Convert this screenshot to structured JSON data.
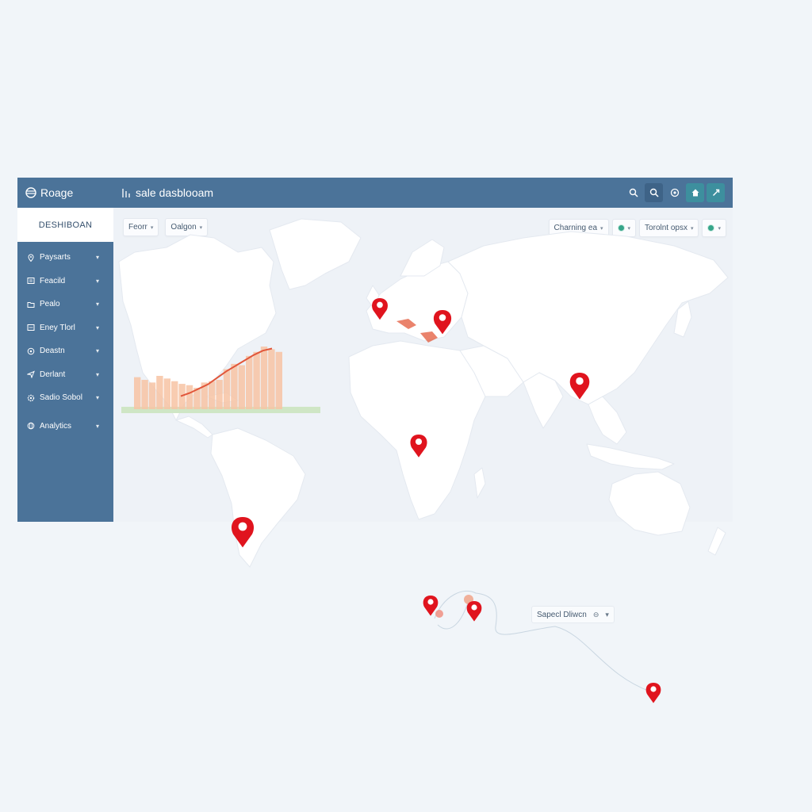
{
  "app": {
    "brand": "Roage",
    "title": "sale dasblooam"
  },
  "topbar": {
    "actions": [
      {
        "icon": "search-icon"
      },
      {
        "icon": "search-icon"
      },
      {
        "icon": "settings-icon"
      },
      {
        "icon": "home-icon"
      },
      {
        "icon": "expand-icon"
      }
    ]
  },
  "sidebar": {
    "header": "DESHIBOAN",
    "items": [
      {
        "label": "Paysarts",
        "icon": "location-pin-icon"
      },
      {
        "label": "Feacild",
        "icon": "document-icon"
      },
      {
        "label": "Pealo",
        "icon": "folder-icon"
      },
      {
        "label": "Eney Tlorl",
        "icon": "list-icon"
      },
      {
        "label": "Deastn",
        "icon": "target-icon"
      },
      {
        "label": "Derlant",
        "icon": "send-icon"
      },
      {
        "label": "Sadio Sobol",
        "icon": "gear-icon"
      },
      {
        "label": "Analytics",
        "icon": "globe-icon"
      }
    ]
  },
  "filters": {
    "left": [
      {
        "label": "Feorr"
      },
      {
        "label": "Oalgon"
      }
    ],
    "right": [
      {
        "label": "Charning ea"
      },
      {
        "label": "Torolnt opsx"
      }
    ]
  },
  "floating_label": {
    "text": "Sapecl Dliwcn"
  },
  "colors": {
    "topbar": "#4b7399",
    "sidebar": "#4b7399",
    "pin": "#e0141e",
    "chart_bar": "#f7c3a3",
    "chart_line": "#e1563a",
    "background": "#f1f5f9"
  },
  "chart_data": {
    "type": "bar",
    "values": [
      48,
      44,
      40,
      50,
      46,
      42,
      38,
      36,
      32,
      40,
      42,
      44,
      60,
      68,
      66,
      80,
      86,
      94,
      90,
      86
    ],
    "line": [
      24,
      30,
      38,
      46,
      58,
      70,
      80,
      90,
      100,
      108,
      112
    ]
  }
}
